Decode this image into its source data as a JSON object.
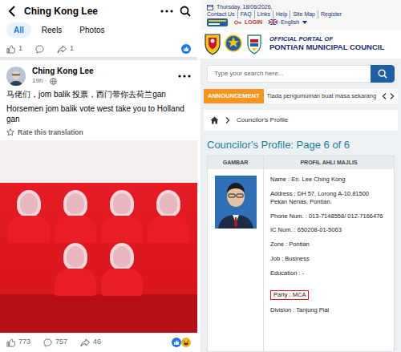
{
  "facebook": {
    "page_title": "Ching Kong Lee",
    "filters": [
      {
        "label": "All",
        "selected": true
      },
      {
        "label": "Reels",
        "selected": false
      },
      {
        "label": "Photos",
        "selected": false
      }
    ],
    "previous_post": {
      "likes": "1",
      "shares": "1"
    },
    "post": {
      "author": "Ching Kong Lee",
      "time": "19h ·",
      "text": "马佬们，jom balik 投票，西门带你去荷兰gan",
      "translation": "Horsemen jom balik vote west take you to Holland gan",
      "rate_link": "Rate this translation",
      "reactions": "773",
      "comments": "757",
      "shares": "46"
    }
  },
  "portal": {
    "date": "Thursday, 18/06/2026,",
    "top_links": [
      "Contact Us",
      "FAQ",
      "Links",
      "Help",
      "Site Map",
      "Register"
    ],
    "login": "LOGIN",
    "language": "English",
    "portal_label": "OFFICIAL PORTAL OF",
    "council_name": "PONTIAN MUNICIPAL COUNCIL",
    "search": {
      "placeholder": "Type your search here..."
    },
    "announcement": {
      "label": "ANNOUNCEMENT",
      "text": "Tiada pengumuman buat masa sekarang"
    },
    "breadcrumb": "Councilor's Profile",
    "title": "Councilor's Profile: Page 6 of 6",
    "table": {
      "columns": [
        "GAMBAR",
        "PROFIL AHLI MAJLIS"
      ],
      "fields": [
        {
          "text": "Name : En. Lee Ching Kong",
          "highlighted": false
        },
        {
          "text": "Address : DH 57, Lorong A-10,81500 Pekan Nenas, Pontian.",
          "highlighted": false
        },
        {
          "text": "Phone Num. : 013-7148558/ 012-7166476",
          "highlighted": false
        },
        {
          "text": "IC Num. : 650208-01-5063",
          "highlighted": false
        },
        {
          "text": "Zone : Pontian",
          "highlighted": false
        },
        {
          "text": "Job : Business",
          "highlighted": false
        },
        {
          "text": "Education : -",
          "highlighted": false
        },
        {
          "text": "Party : MCA",
          "highlighted": true
        },
        {
          "text": "Division : Tanjung Piai",
          "highlighted": false
        }
      ]
    }
  }
}
